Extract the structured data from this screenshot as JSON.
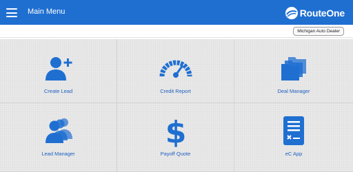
{
  "header": {
    "title": "Main Menu",
    "brand": "RouteOne",
    "menu_icon": "hamburger-menu-icon",
    "background_color": "#1f6fd1"
  },
  "dealer": {
    "name": "Michigan Auto Dealer"
  },
  "tiles": [
    {
      "label": "Create Lead",
      "icon": "add-person-icon"
    },
    {
      "label": "Credit Report",
      "icon": "gauge-icon"
    },
    {
      "label": "Deal Manager",
      "icon": "folders-icon"
    },
    {
      "label": "Lead Manager",
      "icon": "people-group-icon"
    },
    {
      "label": "Payoff Quote",
      "icon": "dollar-sign-icon"
    },
    {
      "label": "eC App",
      "icon": "document-form-icon"
    }
  ],
  "colors": {
    "accent": "#1f6fd1",
    "label_text": "#1f5fbf",
    "grid_background": "#e9e9e9"
  }
}
